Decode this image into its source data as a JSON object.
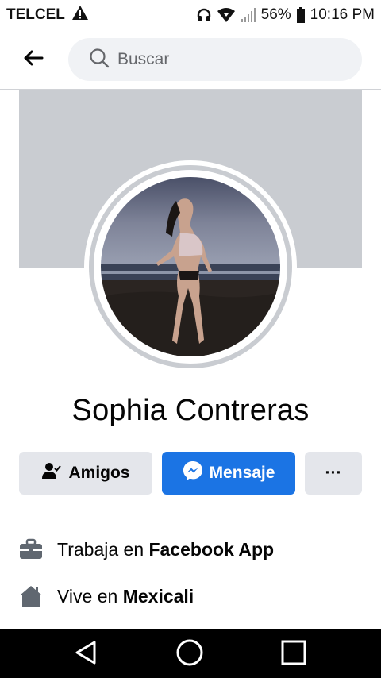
{
  "status_bar": {
    "carrier": "TELCEL",
    "battery": "56%",
    "time": "10:16 PM"
  },
  "header": {
    "search_placeholder": "Buscar"
  },
  "profile": {
    "name": "Sophia Contreras"
  },
  "actions": {
    "friends_label": "Amigos",
    "message_label": "Mensaje",
    "more_label": "···"
  },
  "info": {
    "work_prefix": "Trabaja en ",
    "work_place": "Facebook App",
    "home_prefix": "Vive en ",
    "home_place": "Mexicali"
  },
  "colors": {
    "accent": "#1b74e4",
    "secondary_button": "#e4e6eb",
    "cover": "#c9ccd1"
  },
  "icons": [
    "warning-icon",
    "headphones-icon",
    "wifi-icon",
    "signal-icon",
    "battery-icon",
    "back-arrow-icon",
    "search-icon",
    "friends-icon",
    "messenger-icon",
    "work-icon",
    "home-icon",
    "nav-back-icon",
    "nav-home-icon",
    "nav-recent-icon"
  ]
}
